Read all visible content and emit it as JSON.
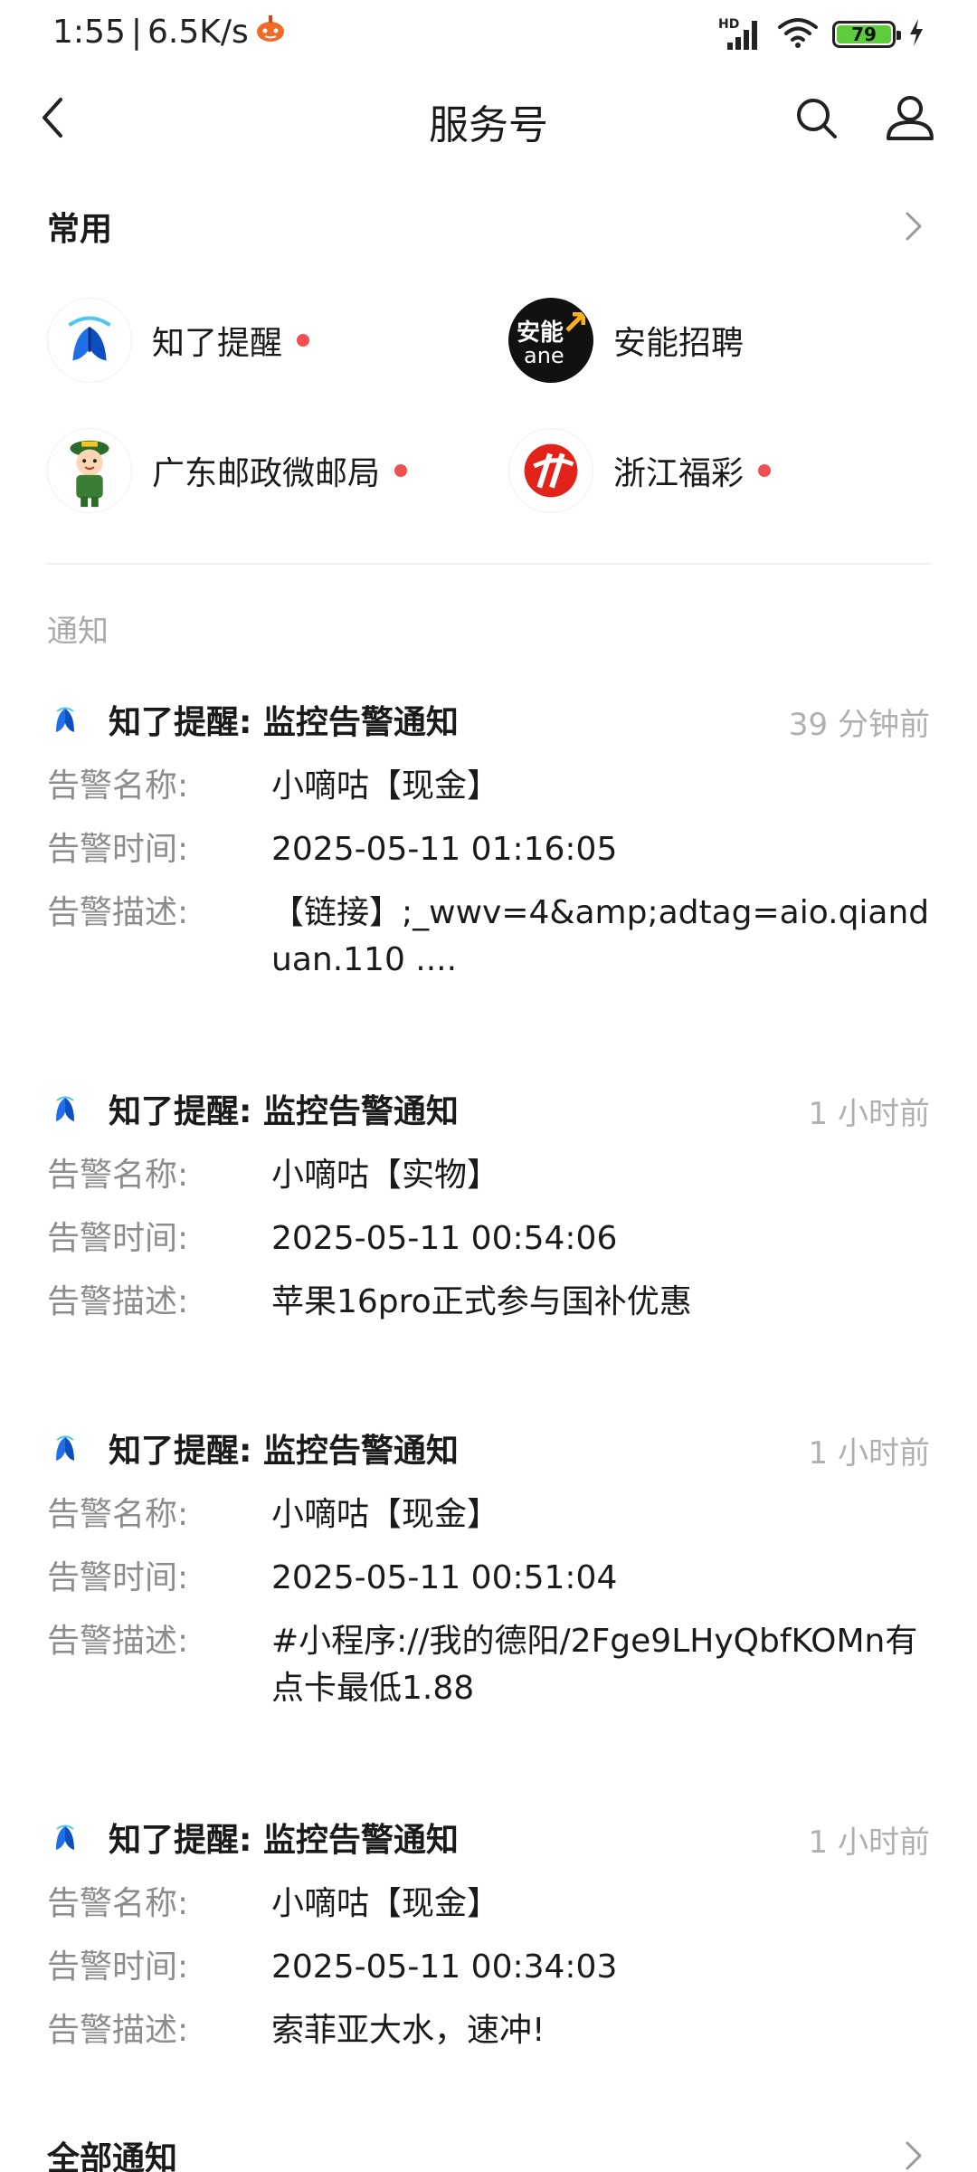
{
  "status_bar": {
    "time": "1:55",
    "speed": "6.5K/s",
    "network": "HD",
    "battery": "79"
  },
  "nav": {
    "title": "服务号"
  },
  "frequent": {
    "title": "常用",
    "accounts": [
      {
        "name": "知了提醒",
        "unread": true
      },
      {
        "name": "安能招聘",
        "unread": false,
        "logo_text": "安能",
        "logo_sub": "ane"
      },
      {
        "name": "广东邮政微邮局",
        "unread": true
      },
      {
        "name": "浙江福彩",
        "unread": true
      }
    ]
  },
  "notices": {
    "section_title": "通知",
    "items": [
      {
        "title": "知了提醒:  监控告警通知",
        "time": "39 分钟前",
        "name_label": "告警名称:",
        "name_value": "小嘀咕【现金】",
        "time_label": "告警时间:",
        "time_value": "2025-05-11 01:16:05",
        "desc_label": "告警描述:",
        "desc_value": "【链接】;_wwv=4&amp;adtag=aio.qianduan.110 ...."
      },
      {
        "title": "知了提醒:  监控告警通知",
        "time": "1 小时前",
        "name_label": "告警名称:",
        "name_value": "小嘀咕【实物】",
        "time_label": "告警时间:",
        "time_value": "2025-05-11 00:54:06",
        "desc_label": "告警描述:",
        "desc_value": "苹果16pro正式参与国补优惠"
      },
      {
        "title": "知了提醒:  监控告警通知",
        "time": "1 小时前",
        "name_label": "告警名称:",
        "name_value": "小嘀咕【现金】",
        "time_label": "告警时间:",
        "time_value": "2025-05-11 00:51:04",
        "desc_label": "告警描述:",
        "desc_value": "#小程序://我的德阳/2Fge9LHyQbfKOMn有点卡最低1.88"
      },
      {
        "title": "知了提醒:  监控告警通知",
        "time": "1 小时前",
        "name_label": "告警名称:",
        "name_value": "小嘀咕【现金】",
        "time_label": "告警时间:",
        "time_value": "2025-05-11 00:34:03",
        "desc_label": "告警描述:",
        "desc_value": "索菲亚大水，速冲!"
      }
    ],
    "all_label": "全部通知"
  },
  "colors": {
    "unread_dot": "#f05050",
    "secondary_text": "#8c8c8c",
    "time_text": "#b0b0b0",
    "battery_fill": "#5fcc3c"
  }
}
